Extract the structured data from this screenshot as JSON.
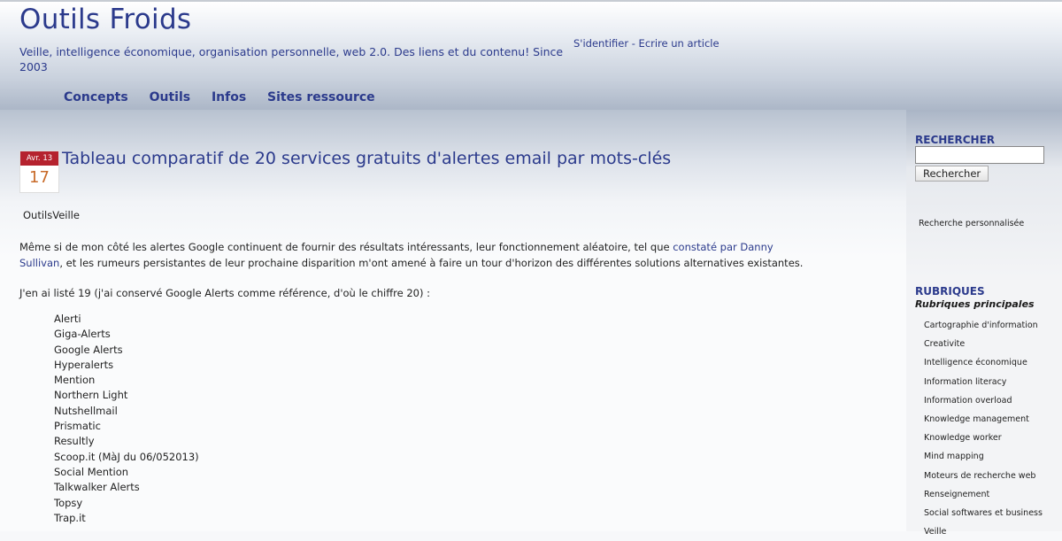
{
  "site": {
    "title": "Outils Froids",
    "tagline": "Veille, intelligence économique, organisation personnelle, web 2.0. Des liens et du contenu! Since 2003"
  },
  "header_links": {
    "login": "S'identifier",
    "separator": " - ",
    "write": "Ecrire un article"
  },
  "nav": [
    "Concepts",
    "Outils",
    "Infos",
    "Sites ressource"
  ],
  "post": {
    "date_month": "Avr. 13",
    "date_day": "17",
    "title": "Tableau comparatif de 20 services gratuits d'alertes email par mots-clés",
    "categories": "OutilsVeille",
    "para1_before": "Même si de mon côté les alertes Google continuent de fournir des résultats intéressants, leur fonctionnement aléatoire, tel que ",
    "para1_link": "constaté par Danny Sullivan",
    "para1_after": ", et les rumeurs persistantes de leur prochaine disparition m'ont amené à faire un tour d'horizon des différentes solutions alternatives existantes.",
    "para2": "J'en ai listé 19 (j'ai conservé Google Alerts comme référence, d'où le chiffre 20) :",
    "services": [
      "Alerti",
      "Giga-Alerts",
      "Google Alerts",
      "Hyperalerts",
      "Mention",
      "Northern Light",
      "Nutshellmail",
      "Prismatic",
      "Resultly",
      "Scoop.it (MàJ du 06/052013)",
      "Social Mention",
      "Talkwalker Alerts",
      "Topsy",
      "Trap.it"
    ]
  },
  "sidebar": {
    "search_heading": "RECHERCHER",
    "search_value": "",
    "search_button": "Rechercher",
    "custom_search": "Recherche personnalisée",
    "rubriques_heading": "RUBRIQUES",
    "rubriques_sub": "Rubriques principales",
    "rubriques": [
      "Cartographie d'information",
      "Creativite",
      "Intelligence économique",
      "Information literacy",
      "Information overload",
      "Knowledge management",
      "Knowledge worker",
      "Mind mapping",
      "Moteurs de recherche web",
      "Renseignement",
      "Social softwares et business",
      "Veille"
    ]
  },
  "colors": {
    "link": "#2b3a8c",
    "date_month_bg": "#b5222e",
    "date_day": "#c86a28"
  }
}
